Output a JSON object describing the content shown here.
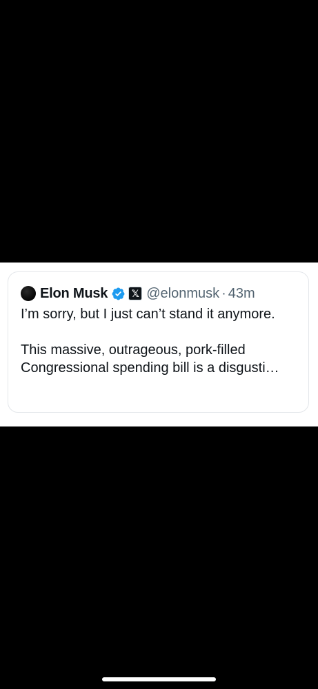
{
  "quoted_tweet": {
    "display_name": "Elon Musk",
    "handle": "@elonmusk",
    "separator": "·",
    "time": "43m",
    "affiliate_badge": "𝕏",
    "paragraphs": [
      "I’m sorry, but I just can’t stand it anymore.",
      "This massive, outrageous, pork-filled Congressional spending bill is a disgusti…"
    ]
  },
  "icons": {
    "verified": "verified-badge-icon",
    "affiliate": "x-logo-icon",
    "avatar": "avatar-image"
  },
  "colors": {
    "background": "#000000",
    "card": "#ffffff",
    "verified_blue": "#1d9bf0",
    "secondary_text": "#536471",
    "primary_text": "#0f1419"
  }
}
